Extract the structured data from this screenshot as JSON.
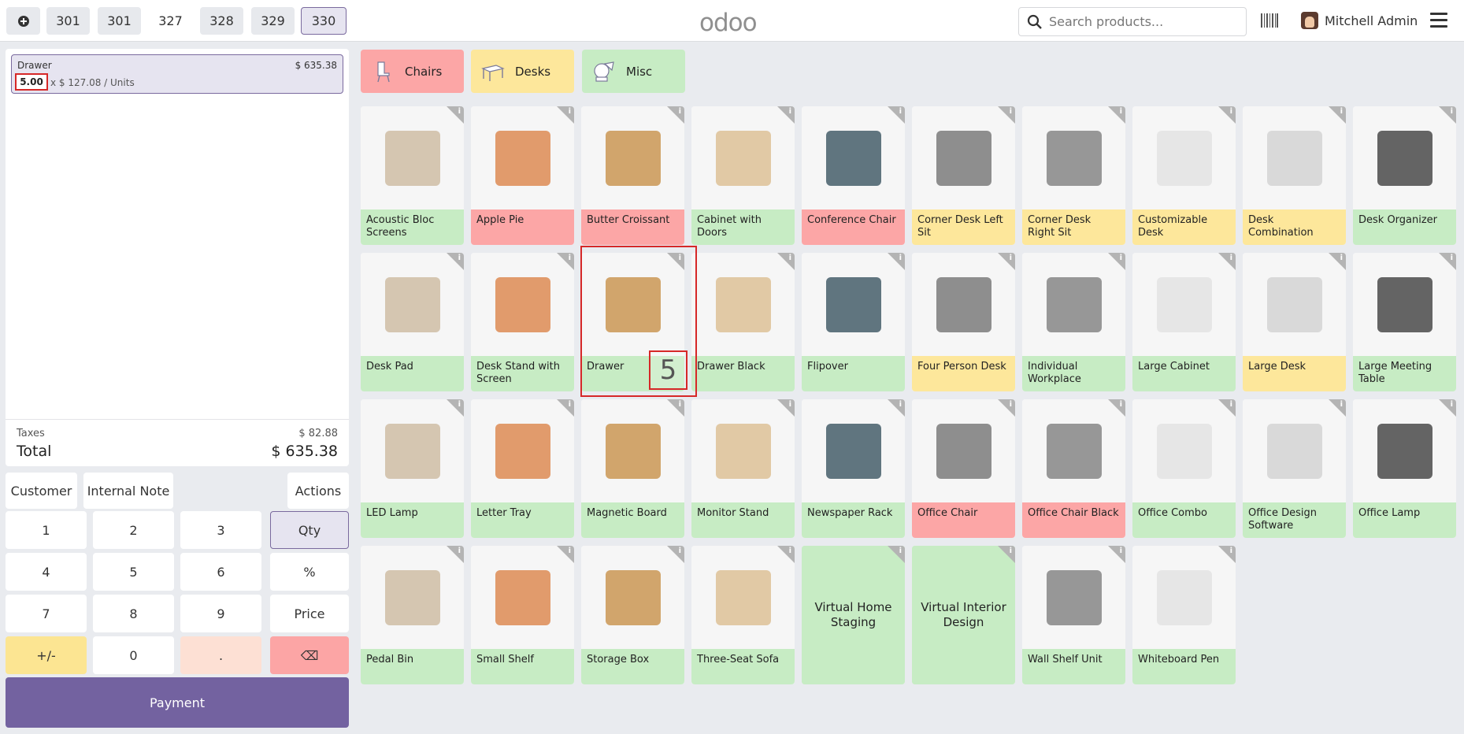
{
  "header": {
    "new_order_label": "+",
    "order_tabs": [
      "301",
      "301",
      "327",
      "328",
      "329",
      "330"
    ],
    "logo": "odoo",
    "search_placeholder": "Search products...",
    "user_name": "Mitchell Admin"
  },
  "order": {
    "line": {
      "name": "Drawer",
      "price": "$ 635.38",
      "qty": "5.00",
      "unit_price": "x $ 127.08 / Units"
    },
    "taxes_label": "Taxes",
    "taxes_value": "$ 82.88",
    "total_label": "Total",
    "total_value": "$ 635.38"
  },
  "controls": {
    "customer": "Customer",
    "internal_note": "Internal Note",
    "actions": "Actions"
  },
  "numpad": {
    "keys": [
      "1",
      "2",
      "3",
      "Qty",
      "4",
      "5",
      "6",
      "%",
      "7",
      "8",
      "9",
      "Price",
      "+/-",
      "0",
      ".",
      "⌫"
    ]
  },
  "payment_label": "Payment",
  "categories": [
    {
      "label": "Chairs",
      "color": "#fca6a6"
    },
    {
      "label": "Desks",
      "color": "#fde79b"
    },
    {
      "label": "Misc",
      "color": "#c7ecc4"
    }
  ],
  "products": [
    {
      "name": "Acoustic Bloc Screens",
      "color": "green"
    },
    {
      "name": "Apple Pie",
      "color": "pink"
    },
    {
      "name": "Butter Croissant",
      "color": "pink"
    },
    {
      "name": "Cabinet with Doors",
      "color": "green"
    },
    {
      "name": "Conference Chair",
      "color": "pink"
    },
    {
      "name": "Corner Desk Left Sit",
      "color": "yellow"
    },
    {
      "name": "Corner Desk Right Sit",
      "color": "yellow"
    },
    {
      "name": "Customizable Desk",
      "color": "yellow"
    },
    {
      "name": "Desk Combination",
      "color": "yellow"
    },
    {
      "name": "Desk Organizer",
      "color": "green"
    },
    {
      "name": "Desk Pad",
      "color": "green"
    },
    {
      "name": "Desk Stand with Screen",
      "color": "green"
    },
    {
      "name": "Drawer",
      "color": "green"
    },
    {
      "name": "Drawer Black",
      "color": "green"
    },
    {
      "name": "Flipover",
      "color": "green"
    },
    {
      "name": "Four Person Desk",
      "color": "yellow"
    },
    {
      "name": "Individual Workplace",
      "color": "green"
    },
    {
      "name": "Large Cabinet",
      "color": "green"
    },
    {
      "name": "Large Desk",
      "color": "yellow"
    },
    {
      "name": "Large Meeting Table",
      "color": "green"
    },
    {
      "name": "LED Lamp",
      "color": "green"
    },
    {
      "name": "Letter Tray",
      "color": "green"
    },
    {
      "name": "Magnetic Board",
      "color": "green"
    },
    {
      "name": "Monitor Stand",
      "color": "green"
    },
    {
      "name": "Newspaper Rack",
      "color": "green"
    },
    {
      "name": "Office Chair",
      "color": "pink"
    },
    {
      "name": "Office Chair Black",
      "color": "pink"
    },
    {
      "name": "Office Combo",
      "color": "green"
    },
    {
      "name": "Office Design Software",
      "color": "green"
    },
    {
      "name": "Office Lamp",
      "color": "green"
    },
    {
      "name": "Pedal Bin",
      "color": "green"
    },
    {
      "name": "Small Shelf",
      "color": "green"
    },
    {
      "name": "Storage Box",
      "color": "green"
    },
    {
      "name": "Three-Seat Sofa",
      "color": "green"
    },
    {
      "name": "Virtual Home Staging",
      "color": "green"
    },
    {
      "name": "Virtual Interior Design",
      "color": "green"
    },
    {
      "name": "Wall Shelf Unit",
      "color": "green"
    },
    {
      "name": "Whiteboard Pen",
      "color": "green"
    }
  ],
  "selected_product_qty": "5"
}
